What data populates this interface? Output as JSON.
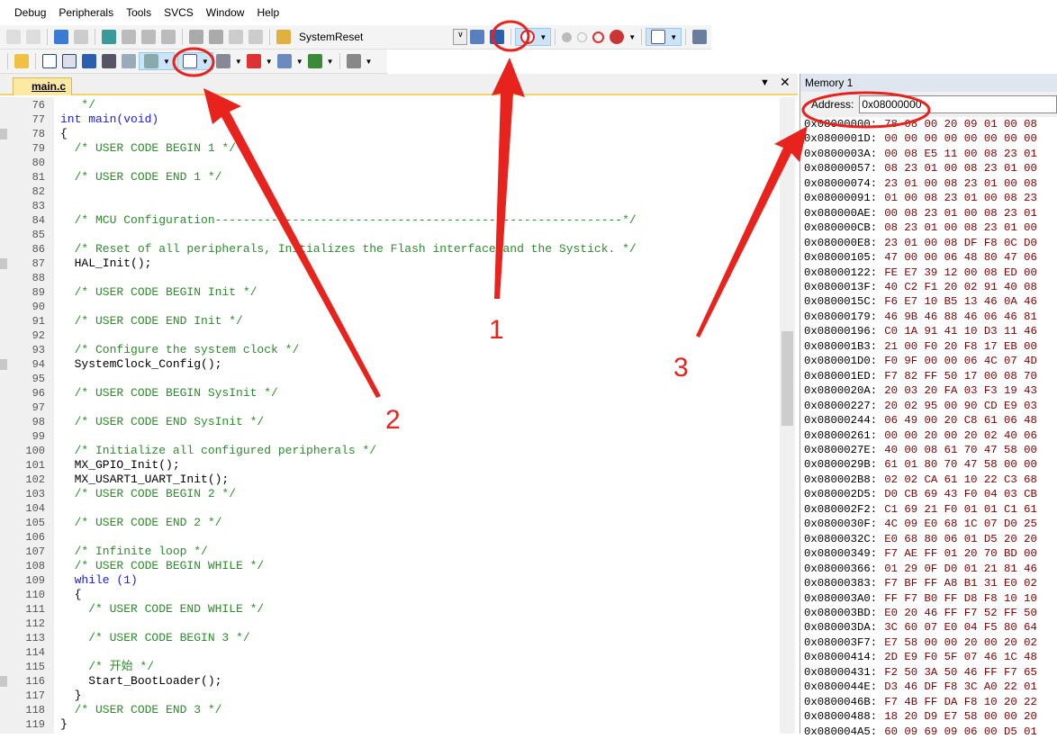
{
  "menu": [
    "Debug",
    "Peripherals",
    "Tools",
    "SVCS",
    "Window",
    "Help"
  ],
  "toolbar": {
    "reset_label": "SystemReset"
  },
  "tab": {
    "file": "main.c"
  },
  "memory": {
    "title": "Memory 1",
    "address_label": "Address:",
    "address_value": "0x08000000",
    "rows": [
      [
        "0x08000000:",
        "78 08 00 20 09 01 00 08"
      ],
      [
        "0x0800001D:",
        "00 00 00 00 00 00 00 00"
      ],
      [
        "0x0800003A:",
        "00 08 E5 11 00 08 23 01"
      ],
      [
        "0x08000057:",
        "08 23 01 00 08 23 01 00"
      ],
      [
        "0x08000074:",
        "23 01 00 08 23 01 00 08"
      ],
      [
        "0x08000091:",
        "01 00 08 23 01 00 08 23"
      ],
      [
        "0x080000AE:",
        "00 08 23 01 00 08 23 01"
      ],
      [
        "0x080000CB:",
        "08 23 01 00 08 23 01 00"
      ],
      [
        "0x080000E8:",
        "23 01 00 08 DF F8 0C D0"
      ],
      [
        "0x08000105:",
        "47 00 00 06 48 80 47 06"
      ],
      [
        "0x08000122:",
        "FE E7 39 12 00 08 ED 00"
      ],
      [
        "0x0800013F:",
        "40 C2 F1 20 02 91 40 08"
      ],
      [
        "0x0800015C:",
        "F6 E7 10 B5 13 46 0A 46"
      ],
      [
        "0x08000179:",
        "46 9B 46 88 46 06 46 81"
      ],
      [
        "0x08000196:",
        "C0 1A 91 41 10 D3 11 46"
      ],
      [
        "0x080001B3:",
        "21 00 F0 20 F8 17 EB 00"
      ],
      [
        "0x080001D0:",
        "F0 9F 00 00 06 4C 07 4D"
      ],
      [
        "0x080001ED:",
        "F7 82 FF 50 17 00 08 70"
      ],
      [
        "0x0800020A:",
        "20 03 20 FA 03 F3 19 43"
      ],
      [
        "0x08000227:",
        "20 02 95 00 90 CD E9 03"
      ],
      [
        "0x08000244:",
        "06 49 00 20 C8 61 06 48"
      ],
      [
        "0x08000261:",
        "00 00 20 00 20 02 40 06"
      ],
      [
        "0x0800027E:",
        "40 00 08 61 70 47 58 00"
      ],
      [
        "0x0800029B:",
        "61 01 80 70 47 58 00 00"
      ],
      [
        "0x080002B8:",
        "02 02 CA 61 10 22 C3 68"
      ],
      [
        "0x080002D5:",
        "D0 CB 69 43 F0 04 03 CB"
      ],
      [
        "0x080002F2:",
        "C1 69 21 F0 01 01 C1 61"
      ],
      [
        "0x0800030F:",
        "4C 09 E0 68 1C 07 D0 25"
      ],
      [
        "0x0800032C:",
        "E0 68 80 06 01 D5 20 20"
      ],
      [
        "0x08000349:",
        "F7 AE FF 01 20 70 BD 00"
      ],
      [
        "0x08000366:",
        "01 29 0F D0 01 21 81 46"
      ],
      [
        "0x08000383:",
        "F7 BF FF A8 B1 31 E0 02"
      ],
      [
        "0x080003A0:",
        "FF F7 B0 FF D8 F8 10 10"
      ],
      [
        "0x080003BD:",
        "E0 20 46 FF F7 52 FF 50"
      ],
      [
        "0x080003DA:",
        "3C 60 07 E0 04 F5 80 64"
      ],
      [
        "0x080003F7:",
        "E7 58 00 00 20 00 20 02"
      ],
      [
        "0x08000414:",
        "2D E9 F0 5F 07 46 1C 48"
      ],
      [
        "0x08000431:",
        "F2 50 3A 50 46 FF F7 65"
      ],
      [
        "0x0800044E:",
        "D3 46 DF F8 3C A0 22 01"
      ],
      [
        "0x0800046B:",
        "F7 4B FF DA F8 10 20 22"
      ],
      [
        "0x08000488:",
        "18 20 D9 E7 58 00 00 20"
      ],
      [
        "0x080004A5:",
        "60 09 69 09 06 00 D5 01"
      ]
    ]
  },
  "code": [
    [
      "76",
      "   */",
      "cm"
    ],
    [
      "77",
      "int main(void)",
      "kw"
    ],
    [
      "78",
      "{",
      ""
    ],
    [
      "79",
      "  /* USER CODE BEGIN 1 */",
      "cm"
    ],
    [
      "80",
      "",
      ""
    ],
    [
      "81",
      "  /* USER CODE END 1 */",
      "cm"
    ],
    [
      "82",
      "",
      ""
    ],
    [
      "83",
      "",
      ""
    ],
    [
      "84",
      "  /* MCU Configuration----------------------------------------------------------*/",
      "cm"
    ],
    [
      "85",
      "",
      ""
    ],
    [
      "86",
      "  /* Reset of all peripherals, Initializes the Flash interface and the Systick. */",
      "cm"
    ],
    [
      "87",
      "  HAL_Init();",
      ""
    ],
    [
      "88",
      "",
      ""
    ],
    [
      "89",
      "  /* USER CODE BEGIN Init */",
      "cm"
    ],
    [
      "90",
      "",
      ""
    ],
    [
      "91",
      "  /* USER CODE END Init */",
      "cm"
    ],
    [
      "92",
      "",
      ""
    ],
    [
      "93",
      "  /* Configure the system clock */",
      "cm"
    ],
    [
      "94",
      "  SystemClock_Config();",
      ""
    ],
    [
      "95",
      "",
      ""
    ],
    [
      "96",
      "  /* USER CODE BEGIN SysInit */",
      "cm"
    ],
    [
      "97",
      "",
      ""
    ],
    [
      "98",
      "  /* USER CODE END SysInit */",
      "cm"
    ],
    [
      "99",
      "",
      ""
    ],
    [
      "100",
      "  /* Initialize all configured peripherals */",
      "cm"
    ],
    [
      "101",
      "  MX_GPIO_Init();",
      ""
    ],
    [
      "102",
      "  MX_USART1_UART_Init();",
      ""
    ],
    [
      "103",
      "  /* USER CODE BEGIN 2 */",
      "cm"
    ],
    [
      "104",
      "",
      ""
    ],
    [
      "105",
      "  /* USER CODE END 2 */",
      "cm"
    ],
    [
      "106",
      "",
      ""
    ],
    [
      "107",
      "  /* Infinite loop */",
      "cm"
    ],
    [
      "108",
      "  /* USER CODE BEGIN WHILE */",
      "cm"
    ],
    [
      "109",
      "  while (1)",
      "kw"
    ],
    [
      "110",
      "  {",
      ""
    ],
    [
      "111",
      "    /* USER CODE END WHILE */",
      "cm"
    ],
    [
      "112",
      "",
      ""
    ],
    [
      "113",
      "    /* USER CODE BEGIN 3 */",
      "cm"
    ],
    [
      "114",
      "",
      ""
    ],
    [
      "115",
      "    /* 开始 */",
      "cm"
    ],
    [
      "116",
      "    Start_BootLoader();",
      ""
    ],
    [
      "117",
      "  }",
      ""
    ],
    [
      "118",
      "  /* USER CODE END 3 */",
      "cm"
    ],
    [
      "119",
      "}",
      ""
    ]
  ],
  "breakpoint_lines": [
    "78",
    "87",
    "94",
    "116"
  ],
  "annotations": {
    "n1": "1",
    "n2": "2",
    "n3": "3"
  },
  "colors": {
    "annotation": "#e8231e",
    "comment": "#2e8b2e",
    "keyword": "#1a1aff"
  }
}
